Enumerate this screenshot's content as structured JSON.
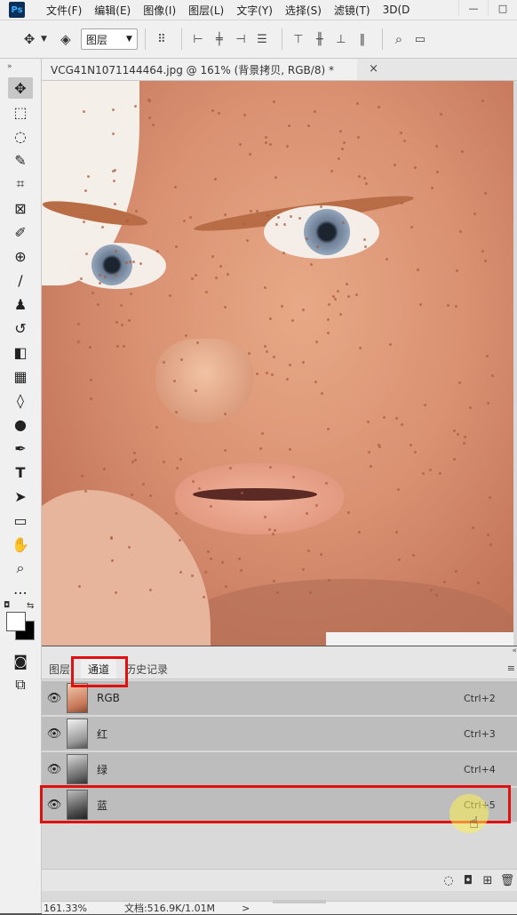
{
  "app": {
    "logo": "Ps"
  },
  "menu": [
    "文件(F)",
    "编辑(E)",
    "图像(I)",
    "图层(L)",
    "文字(Y)",
    "选择(S)",
    "滤镜(T)",
    "3D(D"
  ],
  "window_controls": [
    "—",
    "□"
  ],
  "options_bar": {
    "move_icon": "move-icon",
    "layer_select": "图层",
    "align_icons": [
      "align-left-icon",
      "align-hcenter-icon",
      "align-right-icon",
      "distribute-icon",
      "align-top-icon",
      "align-vcenter-icon",
      "align-bottom-icon"
    ],
    "search_icon": "search-icon"
  },
  "document_tab": {
    "title": "VCG41N1071144464.jpg @ 161% (背景拷贝, RGB/8) *",
    "close": "×"
  },
  "tools": [
    "move",
    "marquee",
    "lasso",
    "quick-select",
    "crop",
    "frame",
    "eyedropper",
    "healing",
    "brush",
    "stamp",
    "history-brush",
    "eraser",
    "gradient",
    "blur",
    "dodge",
    "pen",
    "type",
    "path-select",
    "rectangle",
    "hand",
    "zoom",
    "more"
  ],
  "tool_glyphs": [
    "✥",
    "⬚",
    "◌",
    "✎",
    "⌗",
    "⊠",
    "✐",
    "⊕",
    "∕",
    "♟",
    "↺",
    "◧",
    "▦",
    "◊",
    "●",
    "✒",
    "T",
    "➤",
    "▭",
    "✋",
    "⌕",
    "⋯"
  ],
  "panel": {
    "tabs": {
      "layers": "图层",
      "channels": "通道",
      "history": "历史记录"
    },
    "channels": [
      {
        "name": "RGB",
        "shortcut": "Ctrl+2"
      },
      {
        "name": "红",
        "shortcut": "Ctrl+3"
      },
      {
        "name": "绿",
        "shortcut": "Ctrl+4"
      },
      {
        "name": "蓝",
        "shortcut": "Ctrl+5"
      }
    ],
    "footer_icons": [
      "load-selection-icon",
      "save-selection-icon",
      "new-channel-icon",
      "delete-channel-icon"
    ]
  },
  "status": {
    "zoom": "161.33%",
    "doc": "文档:516.9K/1.01M",
    "arrow": ">"
  }
}
